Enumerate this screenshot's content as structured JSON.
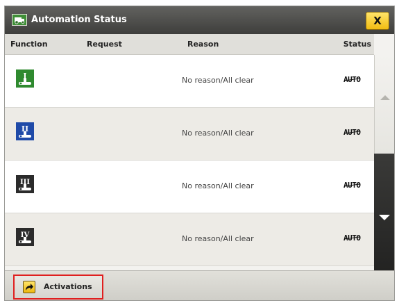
{
  "dialog": {
    "title": "Automation Status",
    "close_label": "X"
  },
  "table": {
    "headers": {
      "function": "Function",
      "request": "Request",
      "reason": "Reason",
      "status": "Status"
    },
    "rows": [
      {
        "function_icon": "implement-i-icon",
        "function_numeral": "I",
        "icon_color": "#2f8a2f",
        "request": "",
        "reason": "No reason/All clear",
        "status": "AUTO"
      },
      {
        "function_icon": "implement-ii-icon",
        "function_numeral": "II",
        "icon_color": "#1f4aa8",
        "request": "",
        "reason": "No reason/All clear",
        "status": "AUTO"
      },
      {
        "function_icon": "implement-iii-icon",
        "function_numeral": "III",
        "icon_color": "#2b2b2b",
        "request": "",
        "reason": "No reason/All clear",
        "status": "AUTO"
      },
      {
        "function_icon": "implement-iv-icon",
        "function_numeral": "IV",
        "icon_color": "#2b2b2b",
        "request": "",
        "reason": "No reason/All clear",
        "status": "AUTO"
      }
    ]
  },
  "footer": {
    "activations_label": "Activations"
  },
  "colors": {
    "titlebar": "#4e4e4c",
    "close_button": "#f6c81d",
    "highlight_border": "#e01f1f"
  }
}
